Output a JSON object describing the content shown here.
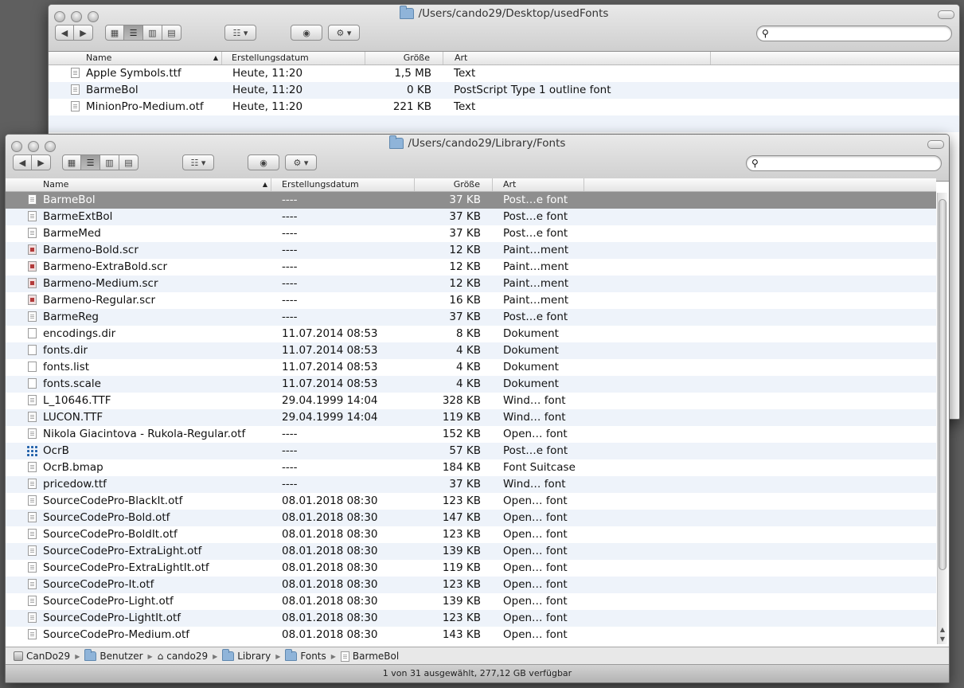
{
  "back_window": {
    "title": "/Users/cando29/Desktop/usedFonts",
    "columns": {
      "name": "Name",
      "date": "Erstellungsdatum",
      "size": "Größe",
      "kind": "Art"
    },
    "rows": [
      {
        "name": "Apple Symbols.ttf",
        "date": "Heute, 11:20",
        "size": "1,5 MB",
        "kind": "Text"
      },
      {
        "name": "BarmeBol",
        "date": "Heute, 11:20",
        "size": "0 KB",
        "kind": "PostScript Type 1 outline font"
      },
      {
        "name": "MinionPro-Medium.otf",
        "date": "Heute, 11:20",
        "size": "221 KB",
        "kind": "Text"
      }
    ]
  },
  "front_window": {
    "title": "/Users/cando29/Library/Fonts",
    "columns": {
      "name": "Name",
      "date": "Erstellungsdatum",
      "size": "Größe",
      "kind": "Art"
    },
    "rows": [
      {
        "name": "BarmeBol",
        "date": "----",
        "size": "37 KB",
        "kind": "Post…e font",
        "icon": "generic"
      },
      {
        "name": "BarmeExtBol",
        "date": "----",
        "size": "37 KB",
        "kind": "Post…e font",
        "icon": "generic"
      },
      {
        "name": "BarmeMed",
        "date": "----",
        "size": "37 KB",
        "kind": "Post…e font",
        "icon": "generic"
      },
      {
        "name": "Barmeno-Bold.scr",
        "date": "----",
        "size": "12 KB",
        "kind": "Paint…ment",
        "icon": "paint"
      },
      {
        "name": "Barmeno-ExtraBold.scr",
        "date": "----",
        "size": "12 KB",
        "kind": "Paint…ment",
        "icon": "paint"
      },
      {
        "name": "Barmeno-Medium.scr",
        "date": "----",
        "size": "12 KB",
        "kind": "Paint…ment",
        "icon": "paint"
      },
      {
        "name": "Barmeno-Regular.scr",
        "date": "----",
        "size": "16 KB",
        "kind": "Paint…ment",
        "icon": "paint"
      },
      {
        "name": "BarmeReg",
        "date": "----",
        "size": "37 KB",
        "kind": "Post…e font",
        "icon": "generic"
      },
      {
        "name": "encodings.dir",
        "date": "11.07.2014 08:53",
        "size": "8 KB",
        "kind": "Dokument",
        "icon": "blank"
      },
      {
        "name": "fonts.dir",
        "date": "11.07.2014 08:53",
        "size": "4 KB",
        "kind": "Dokument",
        "icon": "blank"
      },
      {
        "name": "fonts.list",
        "date": "11.07.2014 08:53",
        "size": "4 KB",
        "kind": "Dokument",
        "icon": "blank"
      },
      {
        "name": "fonts.scale",
        "date": "11.07.2014 08:53",
        "size": "4 KB",
        "kind": "Dokument",
        "icon": "blank"
      },
      {
        "name": "L_10646.TTF",
        "date": "29.04.1999 14:04",
        "size": "328 KB",
        "kind": "Wind… font",
        "icon": "generic"
      },
      {
        "name": "LUCON.TTF",
        "date": "29.04.1999 14:04",
        "size": "119 KB",
        "kind": "Wind… font",
        "icon": "generic"
      },
      {
        "name": "Nikola Giacintova  - Rukola-Regular.otf",
        "date": "----",
        "size": "152 KB",
        "kind": "Open… font",
        "icon": "generic"
      },
      {
        "name": "OcrB",
        "date": "----",
        "size": "57 KB",
        "kind": "Post…e font",
        "icon": "ocr"
      },
      {
        "name": "OcrB.bmap",
        "date": "----",
        "size": "184 KB",
        "kind": "Font Suitcase",
        "icon": "generic"
      },
      {
        "name": "pricedow.ttf",
        "date": "----",
        "size": "37 KB",
        "kind": "Wind… font",
        "icon": "generic"
      },
      {
        "name": "SourceCodePro-BlackIt.otf",
        "date": "08.01.2018 08:30",
        "size": "123 KB",
        "kind": "Open… font",
        "icon": "generic"
      },
      {
        "name": "SourceCodePro-Bold.otf",
        "date": "08.01.2018 08:30",
        "size": "147 KB",
        "kind": "Open… font",
        "icon": "generic"
      },
      {
        "name": "SourceCodePro-BoldIt.otf",
        "date": "08.01.2018 08:30",
        "size": "123 KB",
        "kind": "Open… font",
        "icon": "generic"
      },
      {
        "name": "SourceCodePro-ExtraLight.otf",
        "date": "08.01.2018 08:30",
        "size": "139 KB",
        "kind": "Open… font",
        "icon": "generic"
      },
      {
        "name": "SourceCodePro-ExtraLightIt.otf",
        "date": "08.01.2018 08:30",
        "size": "119 KB",
        "kind": "Open… font",
        "icon": "generic"
      },
      {
        "name": "SourceCodePro-It.otf",
        "date": "08.01.2018 08:30",
        "size": "123 KB",
        "kind": "Open… font",
        "icon": "generic"
      },
      {
        "name": "SourceCodePro-Light.otf",
        "date": "08.01.2018 08:30",
        "size": "139 KB",
        "kind": "Open… font",
        "icon": "generic"
      },
      {
        "name": "SourceCodePro-LightIt.otf",
        "date": "08.01.2018 08:30",
        "size": "123 KB",
        "kind": "Open… font",
        "icon": "generic"
      },
      {
        "name": "SourceCodePro-Medium.otf",
        "date": "08.01.2018 08:30",
        "size": "143 KB",
        "kind": "Open… font",
        "icon": "generic"
      }
    ],
    "selected_index": 0,
    "path": [
      {
        "label": "CanDo29",
        "icon": "hard-drive-icon"
      },
      {
        "label": "Benutzer",
        "icon": "folder-icon"
      },
      {
        "label": "cando29",
        "icon": "home-icon"
      },
      {
        "label": "Library",
        "icon": "folder-icon"
      },
      {
        "label": "Fonts",
        "icon": "folder-icon"
      },
      {
        "label": "BarmeBol",
        "icon": "file-icon"
      }
    ],
    "status": "1 von 31 ausgewählt, 277,12 GB verfügbar"
  }
}
